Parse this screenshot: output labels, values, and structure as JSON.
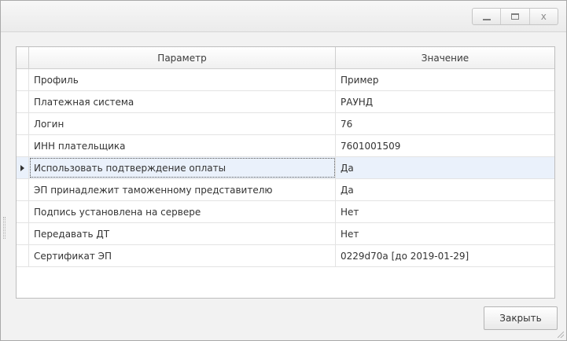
{
  "window": {
    "buttons": {
      "minimize": "_",
      "maximize": "□",
      "close": "x"
    }
  },
  "grid": {
    "columns": {
      "param": "Параметр",
      "value": "Значение"
    },
    "selected_row_index": 4,
    "rows": [
      {
        "param": "Профиль",
        "value": "Пример"
      },
      {
        "param": "Платежная система",
        "value": "РАУНД"
      },
      {
        "param": "Логин",
        "value": "76"
      },
      {
        "param": "ИНН плательщика",
        "value": "7601001509"
      },
      {
        "param": "Использовать подтверждение оплаты",
        "value": "Да"
      },
      {
        "param": "ЭП принадлежит таможенному представителю",
        "value": "Да"
      },
      {
        "param": "Подпись установлена на сервере",
        "value": "Нет"
      },
      {
        "param": "Передавать ДТ",
        "value": "Нет"
      },
      {
        "param": "Сертификат ЭП",
        "value": "0229d70a [до 2019-01-29]"
      }
    ]
  },
  "footer": {
    "close_label": "Закрыть"
  }
}
